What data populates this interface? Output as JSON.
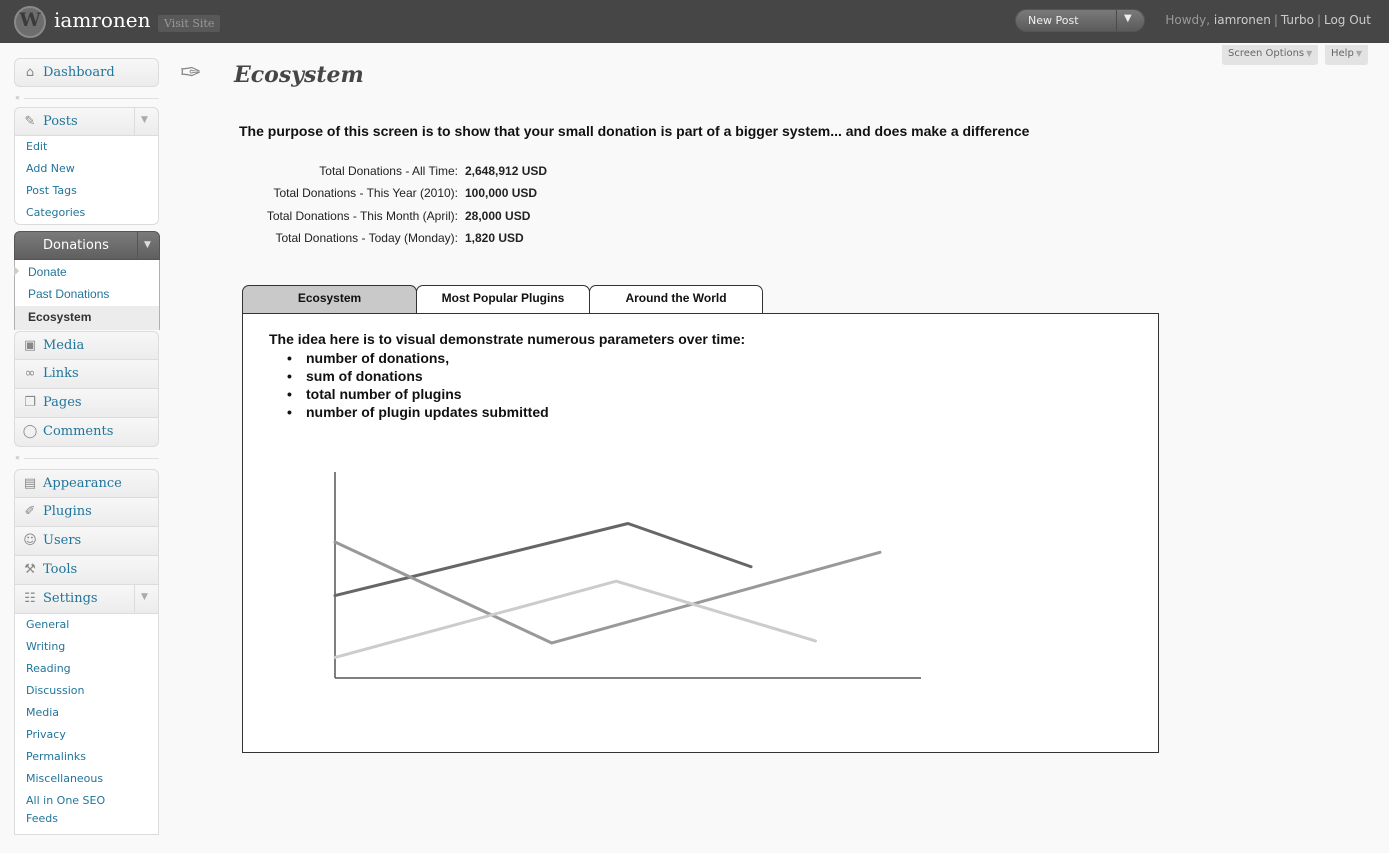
{
  "header": {
    "logo_letter": "W",
    "site_title": "iamronen",
    "visit_site": "Visit Site",
    "new_post": "New Post",
    "howdy": "Howdy,",
    "username": "iamronen",
    "turbo": "Turbo",
    "logout": "Log Out"
  },
  "screen_options": "Screen Options",
  "help": "Help",
  "sidebar": {
    "dashboard": "Dashboard",
    "posts": {
      "label": "Posts",
      "items": [
        "Edit",
        "Add New",
        "Post Tags",
        "Categories"
      ]
    },
    "donations": {
      "label": "Donations",
      "items": [
        "Donate",
        "Past Donations",
        "Ecosystem"
      ]
    },
    "content": [
      "Media",
      "Links",
      "Pages",
      "Comments"
    ],
    "admin": [
      "Appearance",
      "Plugins",
      "Users",
      "Tools"
    ],
    "settings": {
      "label": "Settings",
      "items": [
        "General",
        "Writing",
        "Reading",
        "Discussion",
        "Media",
        "Privacy",
        "Permalinks",
        "Miscellaneous",
        "All in One SEO",
        "Feeds"
      ]
    }
  },
  "page": {
    "title": "Ecosystem",
    "purpose": "The purpose of this screen is to show that your small donation is part of a bigger system... and does make a difference",
    "stats": [
      {
        "label": "Total Donations - All Time:",
        "value": "2,648,912 USD"
      },
      {
        "label": "Total Donations - This Year (2010):",
        "value": "100,000 USD"
      },
      {
        "label": "Total Donations - This Month (April):",
        "value": "28,000 USD"
      },
      {
        "label": "Total Donations - Today (Monday):",
        "value": "1,820 USD"
      }
    ],
    "tabs": [
      "Ecosystem",
      "Most Popular Plugins",
      "Around the World"
    ],
    "idea": "The idea here is to visual demonstrate numerous parameters over time:",
    "parameters": [
      "number of donations,",
      "sum of  donations",
      "total number of plugins",
      "number of plugin updates submitted"
    ]
  },
  "chart_data": {
    "type": "line",
    "xlim": [
      0,
      100
    ],
    "ylim": [
      0,
      100
    ],
    "grid": false,
    "legend": "none",
    "series": [
      {
        "color": "#666666",
        "points": [
          [
            0,
            40
          ],
          [
            50,
            75
          ],
          [
            71,
            54
          ]
        ]
      },
      {
        "color": "#999999",
        "points": [
          [
            0,
            66
          ],
          [
            37,
            17
          ],
          [
            93,
            61
          ]
        ]
      },
      {
        "color": "#cccccc",
        "points": [
          [
            0,
            10
          ],
          [
            48,
            47
          ],
          [
            82,
            18
          ]
        ]
      }
    ]
  }
}
